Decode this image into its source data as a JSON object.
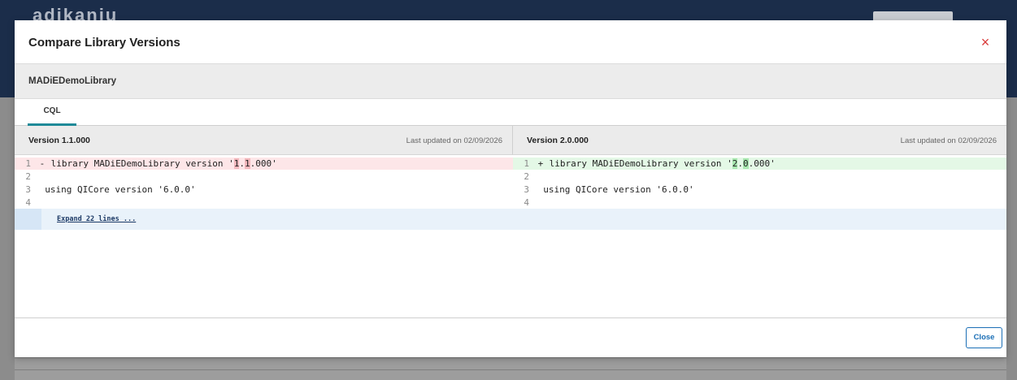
{
  "backdrop": {
    "logo_text": "adikanju"
  },
  "modal": {
    "title": "Compare Library Versions",
    "close_symbol": "×",
    "library_name": "MADiEDemoLibrary",
    "tabs": [
      {
        "label": "CQL",
        "active": true
      }
    ],
    "footer": {
      "close_label": "Close"
    }
  },
  "diff": {
    "left": {
      "version": "Version 1.1.000",
      "updated": "Last updated on 02/09/2026",
      "lines": [
        {
          "num": "1",
          "marker": "-",
          "pre": "library MADiEDemoLibrary version '",
          "hl1": "1",
          "mid": ".",
          "hl2": "1",
          "post": ".000'"
        },
        {
          "num": "2",
          "text": ""
        },
        {
          "num": "3",
          "text": "  using QICore version '6.0.0'"
        },
        {
          "num": "4",
          "text": ""
        }
      ]
    },
    "right": {
      "version": "Version 2.0.000",
      "updated": "Last updated on 02/09/2026",
      "lines": [
        {
          "num": "1",
          "marker": "+",
          "pre": "library MADiEDemoLibrary version '",
          "hl1": "2",
          "mid": ".",
          "hl2": "0",
          "post": ".000'"
        },
        {
          "num": "2",
          "text": ""
        },
        {
          "num": "3",
          "text": "  using QICore version '6.0.0'"
        },
        {
          "num": "4",
          "text": ""
        }
      ]
    },
    "expand_label": "Expand 22 lines ..."
  },
  "colors": {
    "deleted_line": "#fde6e8",
    "added_line": "#e4f8e6",
    "tab_accent": "#1f8a98",
    "close_button": "#1b6fb6",
    "close_x": "#d93b3b"
  }
}
